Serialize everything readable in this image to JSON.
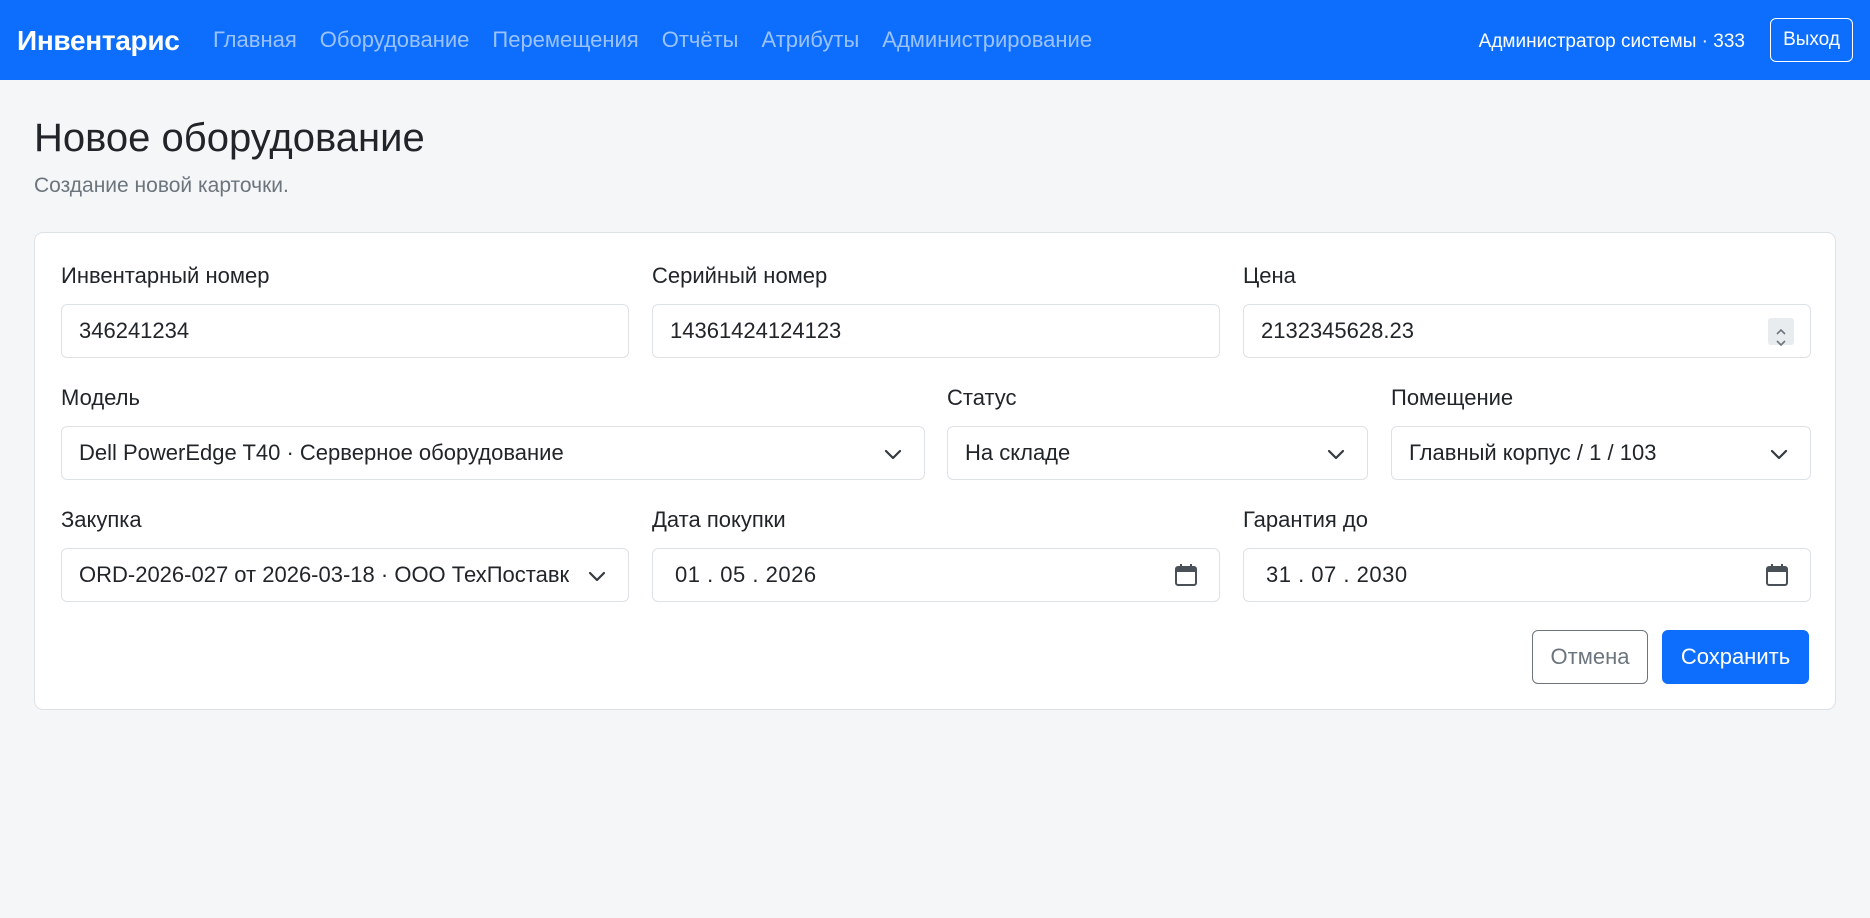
{
  "navbar": {
    "brand": "Инвентарис",
    "links": [
      "Главная",
      "Оборудование",
      "Перемещения",
      "Отчёты",
      "Атрибуты",
      "Администрирование"
    ],
    "user": "Администратор системы · 333",
    "logout_label": "Выход",
    "color": "#0d6efd"
  },
  "page": {
    "title": "Новое оборудование",
    "subtitle": "Создание новой карточки."
  },
  "form": {
    "inventory_number": {
      "label": "Инвентарный номер",
      "value": "346241234"
    },
    "serial_number": {
      "label": "Серийный номер",
      "value": "14361424124123"
    },
    "price": {
      "label": "Цена",
      "value": "2132345628.23"
    },
    "model": {
      "label": "Модель",
      "value": "Dell PowerEdge T40 · Серверное оборудование"
    },
    "status": {
      "label": "Статус",
      "value": "На складе"
    },
    "room": {
      "label": "Помещение",
      "value": "Главный корпус / 1 / 103"
    },
    "purchase": {
      "label": "Закупка",
      "value": "ORD-2026-027 от 2026-03-18 · ООО ТехПоставк"
    },
    "purchase_date": {
      "label": "Дата покупки",
      "value": "01 . 05 . 2026"
    },
    "warranty_until": {
      "label": "Гарантия до",
      "value": "31 . 07 . 2030"
    },
    "cancel_label": "Отмена",
    "save_label": "Сохранить"
  },
  "icons": {
    "select": "chevron-down-icon",
    "date": "calendar-icon",
    "number": "spinner-icon"
  }
}
